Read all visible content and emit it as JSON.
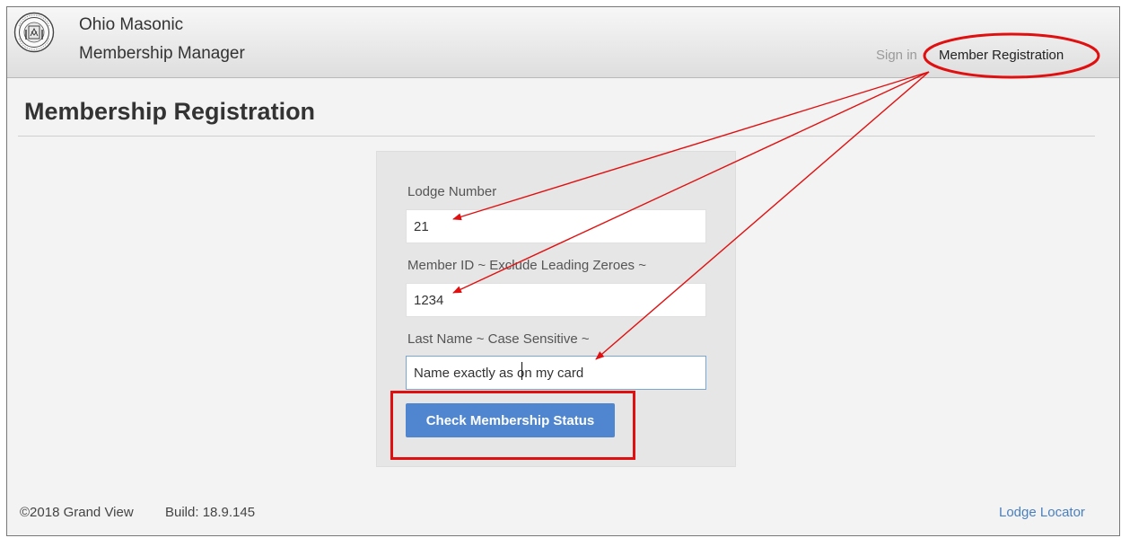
{
  "header": {
    "brand_line1": "Ohio Masonic",
    "brand_line2": "Membership Manager",
    "nav": {
      "sign_in": "Sign in",
      "member_registration": "Member Registration"
    }
  },
  "main": {
    "title": "Membership Registration",
    "form": {
      "lodge_number": {
        "label": "Lodge Number",
        "value": "21"
      },
      "member_id": {
        "label": "Member ID ~ Exclude Leading Zeroes ~",
        "value": "1234"
      },
      "last_name": {
        "label": "Last Name ~ Case Sensitive ~",
        "value": "Name exactly as on my card"
      },
      "submit_label": "Check Membership Status"
    }
  },
  "footer": {
    "copyright": "©2018 Grand View",
    "build": "Build: 18.9.145",
    "lodge_locator": "Lodge Locator"
  },
  "colors": {
    "accent_button": "#4f86cf",
    "link": "#4a7fbe",
    "annotation": "#e01010"
  },
  "icons": {
    "logo": "masonic-seal-icon"
  }
}
